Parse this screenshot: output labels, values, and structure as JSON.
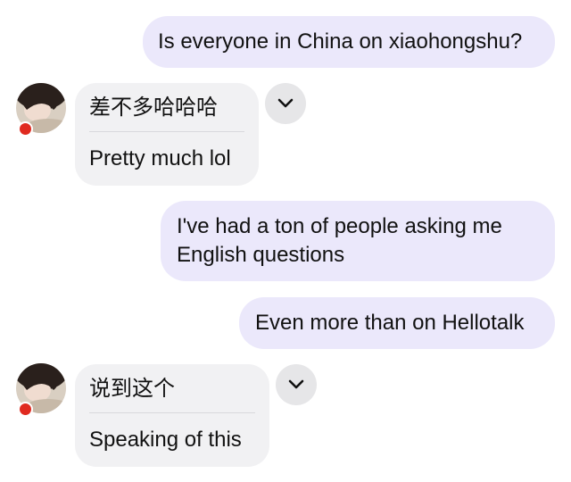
{
  "chat": {
    "messages": [
      {
        "direction": "outgoing",
        "text": "Is everyone in China on xiaohongshu?"
      },
      {
        "direction": "incoming",
        "original": "差不多哈哈哈",
        "translation": "Pretty much lol"
      },
      {
        "direction": "outgoing",
        "text_line1": "I've had a ton of people asking me",
        "text_line2": "English questions"
      },
      {
        "direction": "outgoing",
        "text": "Even more than on Hellotalk"
      },
      {
        "direction": "incoming",
        "original": "说到这个",
        "translation": "Speaking of this"
      }
    ]
  },
  "icons": {
    "toggle": "chevron-down-icon",
    "flag": "china-flag-icon"
  },
  "colors": {
    "outgoing_bubble": "#ebe8fb",
    "incoming_bubble": "#f1f1f3",
    "toggle_button": "#e6e6e8",
    "flag_red": "#e02a20"
  }
}
